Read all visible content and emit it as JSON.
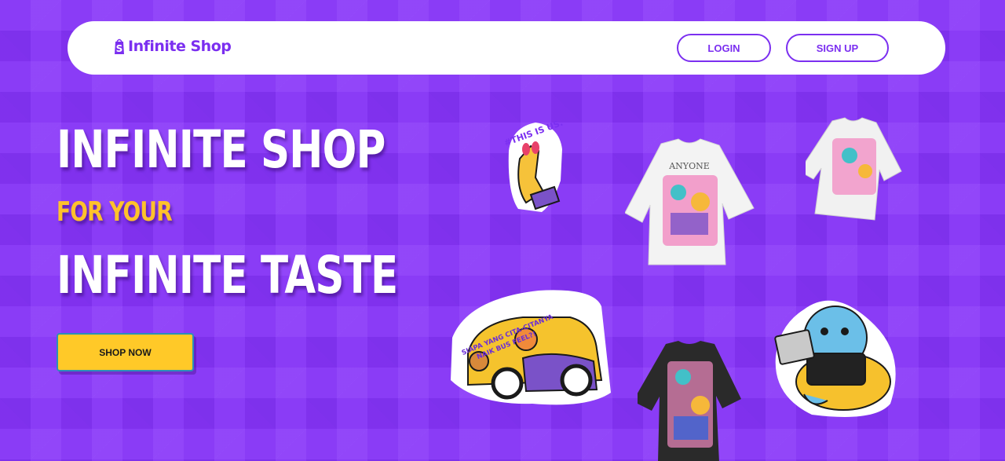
{
  "brand": {
    "name": "Infinite Shop",
    "logo_icon": "shopping-bag-s-logo"
  },
  "nav": {
    "login_label": "LOGIN",
    "signup_label": "SIGN UP"
  },
  "hero": {
    "line1": "INFINITE SHOP",
    "line2": "FOR YOUR",
    "line3": "INFINITE TASTE",
    "cta_label": "SHOP NOW"
  },
  "products": [
    {
      "name": "sticker-this-is-us",
      "text": "#THIS IS US."
    },
    {
      "name": "tshirt-white-anyone",
      "text": "ANYONE"
    },
    {
      "name": "tshirt-white-small"
    },
    {
      "name": "sticker-car",
      "text": "SIAPA YANG CITA-CITANYA NAIK BUS FEEL?!"
    },
    {
      "name": "tshirt-black"
    },
    {
      "name": "sticker-whale-laptop"
    }
  ],
  "colors": {
    "background": "#8a3cf6",
    "accent": "#7b2ff0",
    "highlight": "#ffc22b",
    "cta": "#ffc928"
  }
}
